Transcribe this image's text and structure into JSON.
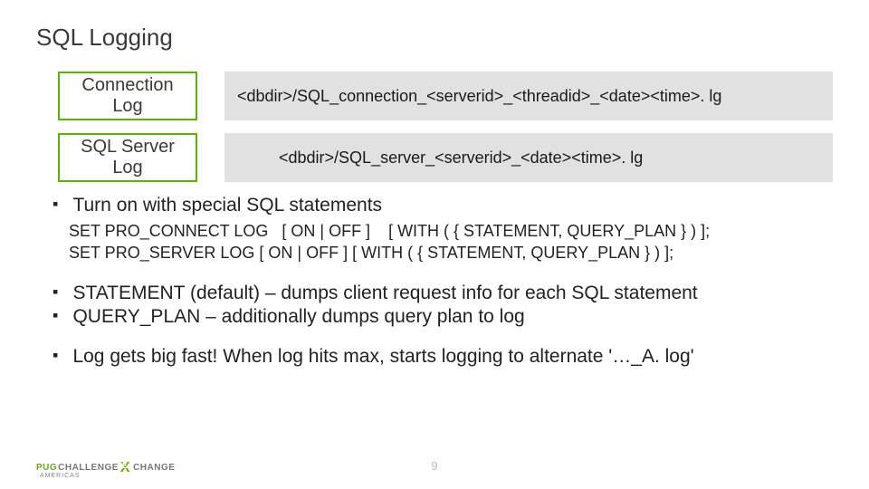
{
  "title": "SQL Logging",
  "rows": [
    {
      "label": "Connection\nLog",
      "path": "<dbdir>/SQL_connection_<serverid>_<threadid>_<date><time>. lg",
      "indent": false
    },
    {
      "label": "SQL Server\nLog",
      "path": "<dbdir>/SQL_server_<serverid>_<date><time>. lg",
      "indent": true
    }
  ],
  "bullets": [
    {
      "text": "Turn on with special SQL statements",
      "code": [
        "SET PRO_CONNECT LOG   [ ON | OFF ]    [ WITH ( { STATEMENT, QUERY_PLAN } ) ];",
        "SET PRO_SERVER LOG [ ON | OFF ] [ WITH ( { STATEMENT, QUERY_PLAN } ) ];"
      ]
    },
    {
      "text": "STATEMENT (default) – dumps client request info for each SQL statement"
    },
    {
      "text": "QUERY_PLAN – additionally dumps query plan to log"
    },
    {
      "text": "Log gets big fast!  When log hits max, starts logging to alternate '…_A. log'"
    }
  ],
  "footer": {
    "pug": "PUG",
    "challenge": "CHALLENGE",
    "change": "CHANGE",
    "sub": "AMERICAS"
  },
  "page_number": "9"
}
